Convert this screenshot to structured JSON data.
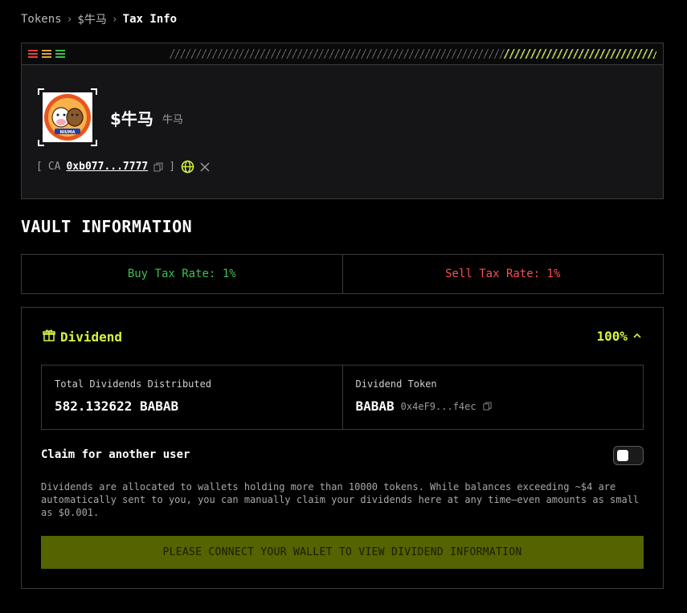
{
  "breadcrumb": {
    "items": [
      "Tokens",
      "$牛马"
    ],
    "separator": "›",
    "current": "Tax Info"
  },
  "token": {
    "name": "$牛马",
    "subtitle": "牛马",
    "logo_text": "NIUMA",
    "ca_label": "CA",
    "ca_open": "[",
    "ca_close": "]",
    "contract_address": "0xb077...7777"
  },
  "vault": {
    "title": "VAULT INFORMATION",
    "buy_tax": "Buy Tax Rate: 1%",
    "sell_tax": "Sell Tax Rate: 1%"
  },
  "dividend": {
    "title": "Dividend",
    "percent": "100%",
    "total_label": "Total Dividends Distributed",
    "total_value": "582.132622 BABAB",
    "token_label": "Dividend Token",
    "token_symbol": "BABAB",
    "token_address": "0x4eF9...f4ec",
    "claim_label": "Claim for another user",
    "claim_toggle_on": false,
    "description": "Dividends are allocated to wallets holding more than 10000 tokens. While balances exceeding ~$4 are automatically sent to you, you can manually claim your dividends here at any time—even amounts as small as $0.001.",
    "connect_button": "PLEASE CONNECT YOUR WALLET TO VIEW DIVIDEND INFORMATION"
  },
  "colors": {
    "accent": "#d4f53c",
    "buy": "#3fbf4f",
    "sell": "#ff4d4d",
    "button_bg": "#556300"
  },
  "icons": [
    "red-lines-icon",
    "orange-lines-icon",
    "green-lines-icon",
    "copy-icon",
    "globe-icon",
    "x-icon",
    "gift-icon",
    "chevron-up-icon"
  ]
}
